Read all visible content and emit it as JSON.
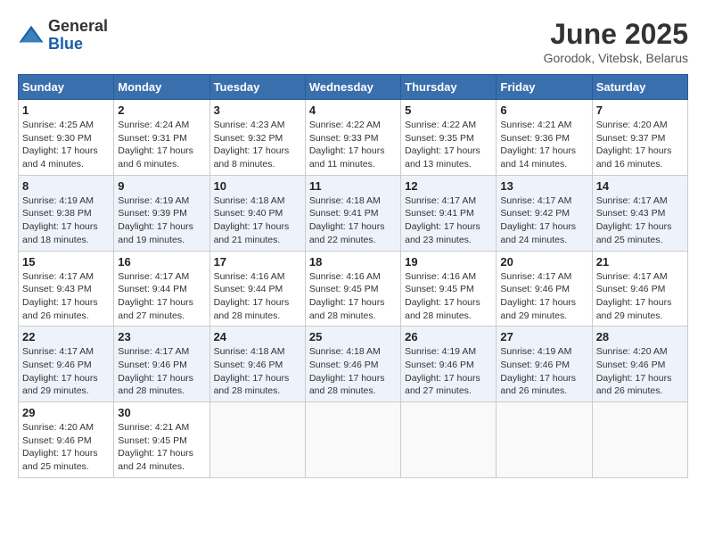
{
  "header": {
    "logo_line1": "General",
    "logo_line2": "Blue",
    "title": "June 2025",
    "subtitle": "Gorodok, Vitebsk, Belarus"
  },
  "days_of_week": [
    "Sunday",
    "Monday",
    "Tuesday",
    "Wednesday",
    "Thursday",
    "Friday",
    "Saturday"
  ],
  "weeks": [
    [
      {
        "day": "1",
        "info": "Sunrise: 4:25 AM\nSunset: 9:30 PM\nDaylight: 17 hours\nand 4 minutes."
      },
      {
        "day": "2",
        "info": "Sunrise: 4:24 AM\nSunset: 9:31 PM\nDaylight: 17 hours\nand 6 minutes."
      },
      {
        "day": "3",
        "info": "Sunrise: 4:23 AM\nSunset: 9:32 PM\nDaylight: 17 hours\nand 8 minutes."
      },
      {
        "day": "4",
        "info": "Sunrise: 4:22 AM\nSunset: 9:33 PM\nDaylight: 17 hours\nand 11 minutes."
      },
      {
        "day": "5",
        "info": "Sunrise: 4:22 AM\nSunset: 9:35 PM\nDaylight: 17 hours\nand 13 minutes."
      },
      {
        "day": "6",
        "info": "Sunrise: 4:21 AM\nSunset: 9:36 PM\nDaylight: 17 hours\nand 14 minutes."
      },
      {
        "day": "7",
        "info": "Sunrise: 4:20 AM\nSunset: 9:37 PM\nDaylight: 17 hours\nand 16 minutes."
      }
    ],
    [
      {
        "day": "8",
        "info": "Sunrise: 4:19 AM\nSunset: 9:38 PM\nDaylight: 17 hours\nand 18 minutes."
      },
      {
        "day": "9",
        "info": "Sunrise: 4:19 AM\nSunset: 9:39 PM\nDaylight: 17 hours\nand 19 minutes."
      },
      {
        "day": "10",
        "info": "Sunrise: 4:18 AM\nSunset: 9:40 PM\nDaylight: 17 hours\nand 21 minutes."
      },
      {
        "day": "11",
        "info": "Sunrise: 4:18 AM\nSunset: 9:41 PM\nDaylight: 17 hours\nand 22 minutes."
      },
      {
        "day": "12",
        "info": "Sunrise: 4:17 AM\nSunset: 9:41 PM\nDaylight: 17 hours\nand 23 minutes."
      },
      {
        "day": "13",
        "info": "Sunrise: 4:17 AM\nSunset: 9:42 PM\nDaylight: 17 hours\nand 24 minutes."
      },
      {
        "day": "14",
        "info": "Sunrise: 4:17 AM\nSunset: 9:43 PM\nDaylight: 17 hours\nand 25 minutes."
      }
    ],
    [
      {
        "day": "15",
        "info": "Sunrise: 4:17 AM\nSunset: 9:43 PM\nDaylight: 17 hours\nand 26 minutes."
      },
      {
        "day": "16",
        "info": "Sunrise: 4:17 AM\nSunset: 9:44 PM\nDaylight: 17 hours\nand 27 minutes."
      },
      {
        "day": "17",
        "info": "Sunrise: 4:16 AM\nSunset: 9:44 PM\nDaylight: 17 hours\nand 28 minutes."
      },
      {
        "day": "18",
        "info": "Sunrise: 4:16 AM\nSunset: 9:45 PM\nDaylight: 17 hours\nand 28 minutes."
      },
      {
        "day": "19",
        "info": "Sunrise: 4:16 AM\nSunset: 9:45 PM\nDaylight: 17 hours\nand 28 minutes."
      },
      {
        "day": "20",
        "info": "Sunrise: 4:17 AM\nSunset: 9:46 PM\nDaylight: 17 hours\nand 29 minutes."
      },
      {
        "day": "21",
        "info": "Sunrise: 4:17 AM\nSunset: 9:46 PM\nDaylight: 17 hours\nand 29 minutes."
      }
    ],
    [
      {
        "day": "22",
        "info": "Sunrise: 4:17 AM\nSunset: 9:46 PM\nDaylight: 17 hours\nand 29 minutes."
      },
      {
        "day": "23",
        "info": "Sunrise: 4:17 AM\nSunset: 9:46 PM\nDaylight: 17 hours\nand 28 minutes."
      },
      {
        "day": "24",
        "info": "Sunrise: 4:18 AM\nSunset: 9:46 PM\nDaylight: 17 hours\nand 28 minutes."
      },
      {
        "day": "25",
        "info": "Sunrise: 4:18 AM\nSunset: 9:46 PM\nDaylight: 17 hours\nand 28 minutes."
      },
      {
        "day": "26",
        "info": "Sunrise: 4:19 AM\nSunset: 9:46 PM\nDaylight: 17 hours\nand 27 minutes."
      },
      {
        "day": "27",
        "info": "Sunrise: 4:19 AM\nSunset: 9:46 PM\nDaylight: 17 hours\nand 26 minutes."
      },
      {
        "day": "28",
        "info": "Sunrise: 4:20 AM\nSunset: 9:46 PM\nDaylight: 17 hours\nand 26 minutes."
      }
    ],
    [
      {
        "day": "29",
        "info": "Sunrise: 4:20 AM\nSunset: 9:46 PM\nDaylight: 17 hours\nand 25 minutes."
      },
      {
        "day": "30",
        "info": "Sunrise: 4:21 AM\nSunset: 9:45 PM\nDaylight: 17 hours\nand 24 minutes."
      },
      {
        "day": "",
        "info": ""
      },
      {
        "day": "",
        "info": ""
      },
      {
        "day": "",
        "info": ""
      },
      {
        "day": "",
        "info": ""
      },
      {
        "day": "",
        "info": ""
      }
    ]
  ]
}
